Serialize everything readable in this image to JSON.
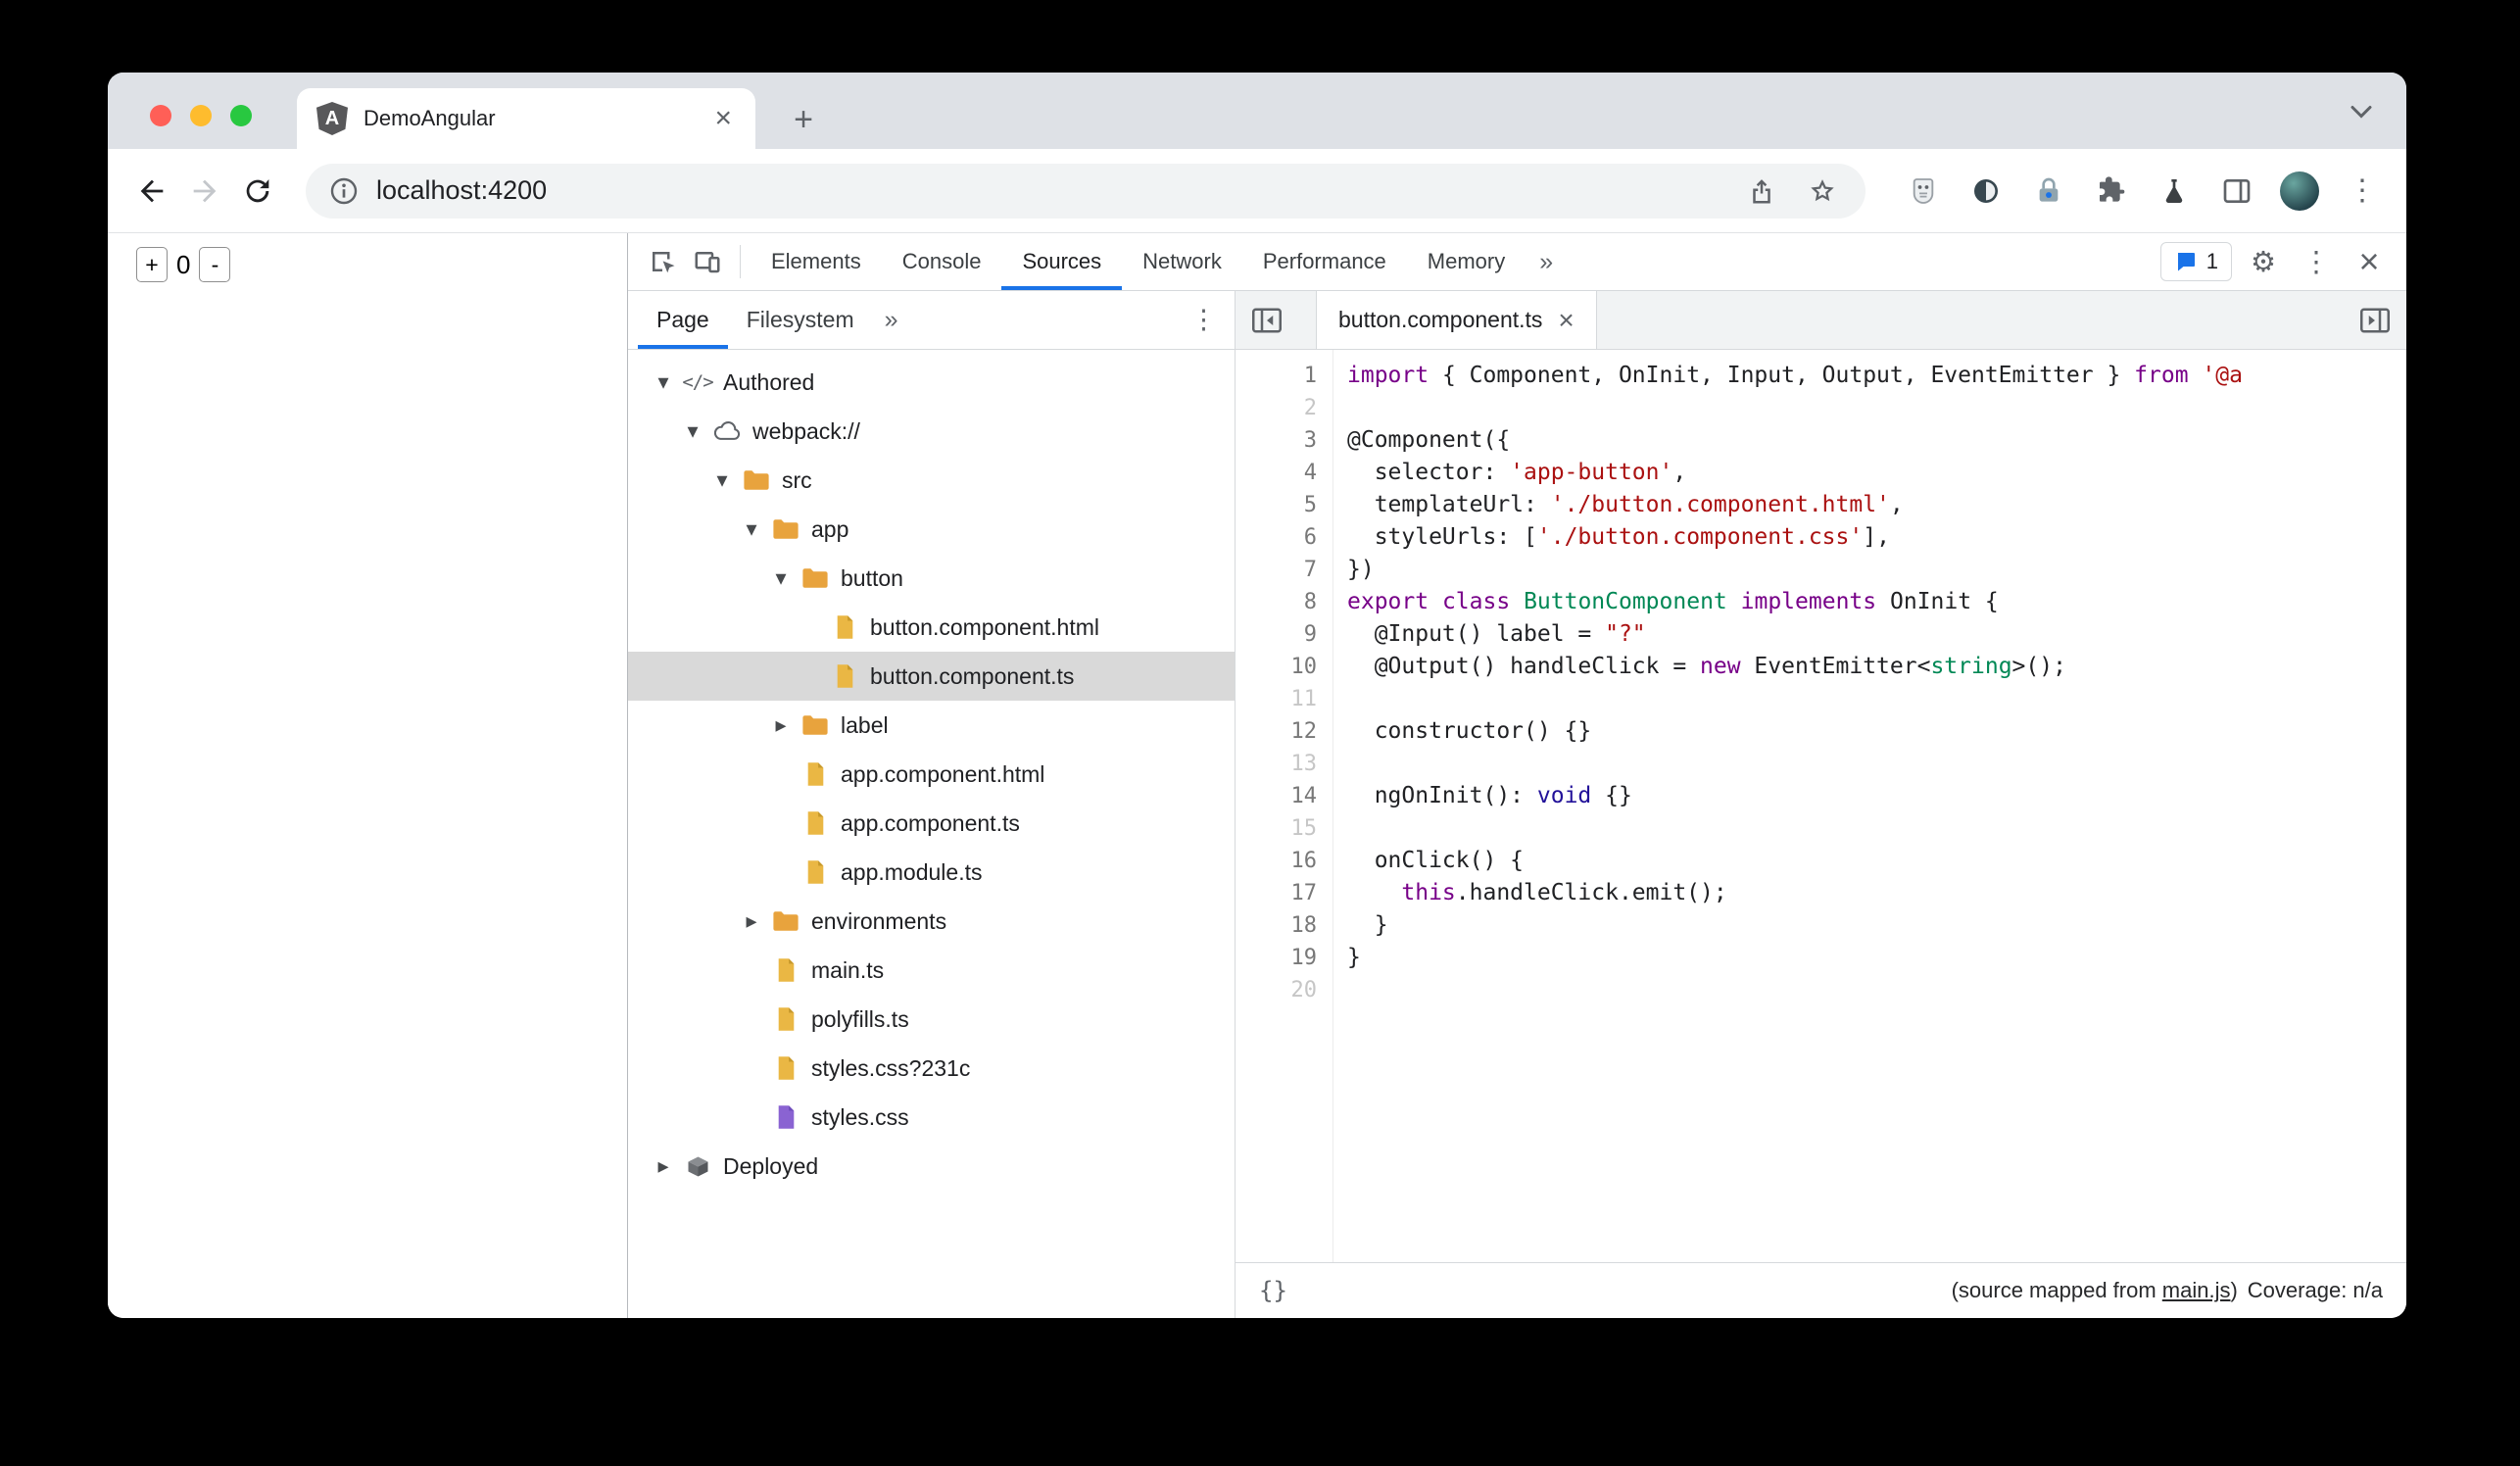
{
  "chrome": {
    "tab_title": "DemoAngular",
    "new_tab": "+",
    "tab_close": "×",
    "url": "localhost:4200"
  },
  "page": {
    "counter": {
      "plus": "+",
      "value": "0",
      "minus": "-"
    }
  },
  "devtools": {
    "toolbar": {
      "tabs": [
        "Elements",
        "Console",
        "Sources",
        "Network",
        "Performance",
        "Memory"
      ],
      "selected": "Sources",
      "more": "»",
      "issues_count": "1"
    },
    "navigator": {
      "tabs": [
        "Page",
        "Filesystem"
      ],
      "selected": "Page",
      "more": "»",
      "tree": [
        {
          "label": "Authored",
          "depth": 0,
          "icon": "code",
          "arrow": "open"
        },
        {
          "label": "webpack://",
          "depth": 1,
          "icon": "cloud",
          "arrow": "open"
        },
        {
          "label": "src",
          "depth": 2,
          "icon": "folder",
          "arrow": "open"
        },
        {
          "label": "app",
          "depth": 3,
          "icon": "folder",
          "arrow": "open"
        },
        {
          "label": "button",
          "depth": 4,
          "icon": "folder",
          "arrow": "open"
        },
        {
          "label": "button.component.html",
          "depth": 5,
          "icon": "file"
        },
        {
          "label": "button.component.ts",
          "depth": 5,
          "icon": "file",
          "selected": true
        },
        {
          "label": "label",
          "depth": 4,
          "icon": "folder",
          "arrow": "closed"
        },
        {
          "label": "app.component.html",
          "depth": 4,
          "icon": "file"
        },
        {
          "label": "app.component.ts",
          "depth": 4,
          "icon": "file"
        },
        {
          "label": "app.module.ts",
          "depth": 4,
          "icon": "file"
        },
        {
          "label": "environments",
          "depth": 3,
          "icon": "folder",
          "arrow": "closed"
        },
        {
          "label": "main.ts",
          "depth": 3,
          "icon": "file"
        },
        {
          "label": "polyfills.ts",
          "depth": 3,
          "icon": "file"
        },
        {
          "label": "styles.css?231c",
          "depth": 3,
          "icon": "file"
        },
        {
          "label": "styles.css",
          "depth": 3,
          "icon": "file-purple"
        },
        {
          "label": "Deployed",
          "depth": 0,
          "icon": "package",
          "arrow": "closed"
        }
      ]
    },
    "editor": {
      "tab": "button.component.ts",
      "close": "×",
      "status_left": "{}",
      "status": {
        "prefix": "(source mapped from ",
        "link": "main.js",
        "suffix": ")",
        "coverage": "Coverage: n/a"
      },
      "lines": [
        {
          "n": "1",
          "t": [
            [
              "kw",
              "import"
            ],
            [
              "pln",
              " { Component, OnInit, Input, Output, EventEmitter } "
            ],
            [
              "kw",
              "from"
            ],
            [
              "pln",
              " "
            ],
            [
              "str",
              "'@a"
            ]
          ]
        },
        {
          "n": "2",
          "t": []
        },
        {
          "n": "3",
          "t": [
            [
              "pln",
              "@Component({"
            ]
          ]
        },
        {
          "n": "4",
          "t": [
            [
              "pln",
              "  selector: "
            ],
            [
              "str",
              "'app-button'"
            ],
            [
              "pln",
              ","
            ]
          ]
        },
        {
          "n": "5",
          "t": [
            [
              "pln",
              "  templateUrl: "
            ],
            [
              "str",
              "'./button.component.html'"
            ],
            [
              "pln",
              ","
            ]
          ]
        },
        {
          "n": "6",
          "t": [
            [
              "pln",
              "  styleUrls: ["
            ],
            [
              "str",
              "'./button.component.css'"
            ],
            [
              "pln",
              "],"
            ]
          ]
        },
        {
          "n": "7",
          "t": [
            [
              "pln",
              "})"
            ]
          ]
        },
        {
          "n": "8",
          "t": [
            [
              "kw",
              "export"
            ],
            [
              "pln",
              " "
            ],
            [
              "kw",
              "class"
            ],
            [
              "pln",
              " "
            ],
            [
              "typ",
              "ButtonComponent"
            ],
            [
              "pln",
              " "
            ],
            [
              "kw",
              "implements"
            ],
            [
              "pln",
              " OnInit {"
            ]
          ]
        },
        {
          "n": "9",
          "t": [
            [
              "pln",
              "  @Input() label = "
            ],
            [
              "str",
              "\"?\""
            ]
          ]
        },
        {
          "n": "10",
          "t": [
            [
              "pln",
              "  @Output() handleClick = "
            ],
            [
              "kw",
              "new"
            ],
            [
              "pln",
              " EventEmitter<"
            ],
            [
              "typ",
              "string"
            ],
            [
              "pln",
              ">();"
            ]
          ]
        },
        {
          "n": "11",
          "t": []
        },
        {
          "n": "12",
          "t": [
            [
              "pln",
              "  constructor() {}"
            ]
          ]
        },
        {
          "n": "13",
          "t": []
        },
        {
          "n": "14",
          "t": [
            [
              "pln",
              "  ngOnInit(): "
            ],
            [
              "atm",
              "void"
            ],
            [
              "pln",
              " {}"
            ]
          ]
        },
        {
          "n": "15",
          "t": []
        },
        {
          "n": "16",
          "t": [
            [
              "pln",
              "  onClick() {"
            ]
          ]
        },
        {
          "n": "17",
          "t": [
            [
              "pln",
              "    "
            ],
            [
              "kw",
              "this"
            ],
            [
              "pln",
              ".handleClick.emit();"
            ]
          ]
        },
        {
          "n": "18",
          "t": [
            [
              "pln",
              "  }"
            ]
          ]
        },
        {
          "n": "19",
          "t": [
            [
              "pln",
              "}"
            ]
          ]
        },
        {
          "n": "20",
          "t": []
        }
      ]
    },
    "colors": {
      "accent": "#1a73e8",
      "keyword": "#770088",
      "string": "#aa1111",
      "type": "#008855",
      "atom": "#221199",
      "folder": "#e8a33d",
      "file": "#eab744",
      "file_purple": "#8a63d2",
      "selection": "#d9d9d9"
    }
  }
}
